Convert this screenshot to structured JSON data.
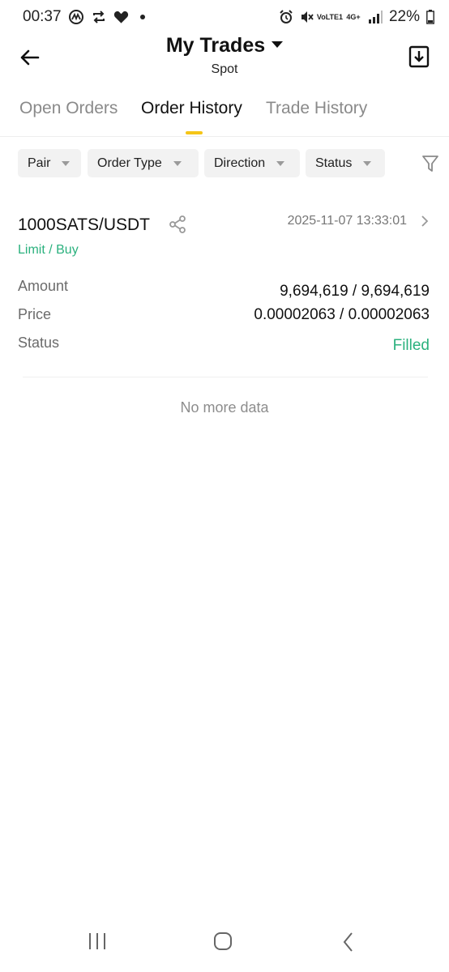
{
  "status_bar": {
    "time": "00:37",
    "left_icons": [
      "coinmarketcap-icon",
      "repeat-icon",
      "heart-icon",
      "dot-icon"
    ],
    "right_icons": [
      "alarm-icon",
      "mute-icon",
      "volte-icon",
      "network-4g-icon",
      "signal-icon",
      "battery-icon"
    ],
    "volte_label": "VoLTE1",
    "net_label": "4G+",
    "battery": "22%"
  },
  "header": {
    "title": "My Trades",
    "subtitle": "Spot"
  },
  "tabs": [
    {
      "label": "Open Orders",
      "active": false
    },
    {
      "label": "Order History",
      "active": true
    },
    {
      "label": "Trade History",
      "active": false
    }
  ],
  "accent_color": "#f5c518",
  "positive_color": "#2bb17e",
  "filters": [
    {
      "label": "Pair"
    },
    {
      "label": "Order Type"
    },
    {
      "label": "Direction"
    },
    {
      "label": "Status"
    }
  ],
  "order": {
    "pair": "1000SATS/USDT",
    "datetime": "2025-11-07 13:33:01",
    "type": "Limit / Buy",
    "rows": [
      {
        "label": "Amount",
        "value": "9,694,619 / 9,694,619"
      },
      {
        "label": "Price",
        "value": "0.00002063 / 0.00002063"
      },
      {
        "label": "Status",
        "value": "Filled"
      }
    ]
  },
  "footer_text": "No more data"
}
